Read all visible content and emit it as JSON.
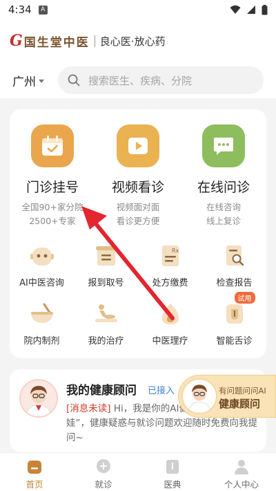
{
  "status_bar": {
    "time": "4:34",
    "notification": "A"
  },
  "brand": {
    "logo_mark": "G",
    "logo_text": "国生堂中医",
    "slogan": "良心医·放心药"
  },
  "search": {
    "city": "广州",
    "placeholder": "搜索医生、疾病、分院"
  },
  "services": {
    "primary": [
      {
        "title": "门诊挂号",
        "sub1": "全国90+家分院",
        "sub2": "2500+专家",
        "icon": "calendar-check-icon",
        "color": "#e9a54b"
      },
      {
        "title": "视频看诊",
        "sub1": "视频面对面",
        "sub2": "看诊更方便",
        "icon": "video-play-icon",
        "color": "#e9b14f"
      },
      {
        "title": "在线问诊",
        "sub1": "在线咨询",
        "sub2": "线上复诊",
        "icon": "chat-bubble-icon",
        "color": "#8cbd5c"
      }
    ],
    "secondary": [
      {
        "label": "AI中医咨询",
        "icon": "ai-robot-icon"
      },
      {
        "label": "报到取号",
        "icon": "ticket-register-icon"
      },
      {
        "label": "处方缴费",
        "icon": "prescription-rx-icon"
      },
      {
        "label": "检查报告",
        "icon": "report-search-icon"
      },
      {
        "label": "院内制剂",
        "icon": "herb-bowl-icon"
      },
      {
        "label": "我的治疗",
        "icon": "massage-treatment-icon"
      },
      {
        "label": "中医理疗",
        "icon": "moxibustion-flame-icon"
      },
      {
        "label": "智能舌诊",
        "icon": "tongue-diagnosis-icon",
        "badge": "试用"
      }
    ]
  },
  "advisor": {
    "title": "我的健康顾问",
    "status": "已接入",
    "unread_tag": "[消息未读]",
    "message": "Hi，我是你的AI健康顾问“国生娃”，健康疑惑与就诊问题欢迎随时免费向我提问~"
  },
  "ai_pill": {
    "small": "有问题问问AI",
    "big": "健康顾问"
  },
  "tabs": [
    {
      "label": "首页",
      "icon": "home-icon",
      "active": true
    },
    {
      "label": "就诊",
      "icon": "plus-chat-icon",
      "active": false
    },
    {
      "label": "医典",
      "icon": "book-icon",
      "active": false
    },
    {
      "label": "个人中心",
      "icon": "user-icon",
      "active": false
    }
  ],
  "colors": {
    "accent": "#c88436",
    "annotation_arrow": "#e3262f",
    "unread": "#d0392b",
    "status_link": "#3f7fd9"
  }
}
